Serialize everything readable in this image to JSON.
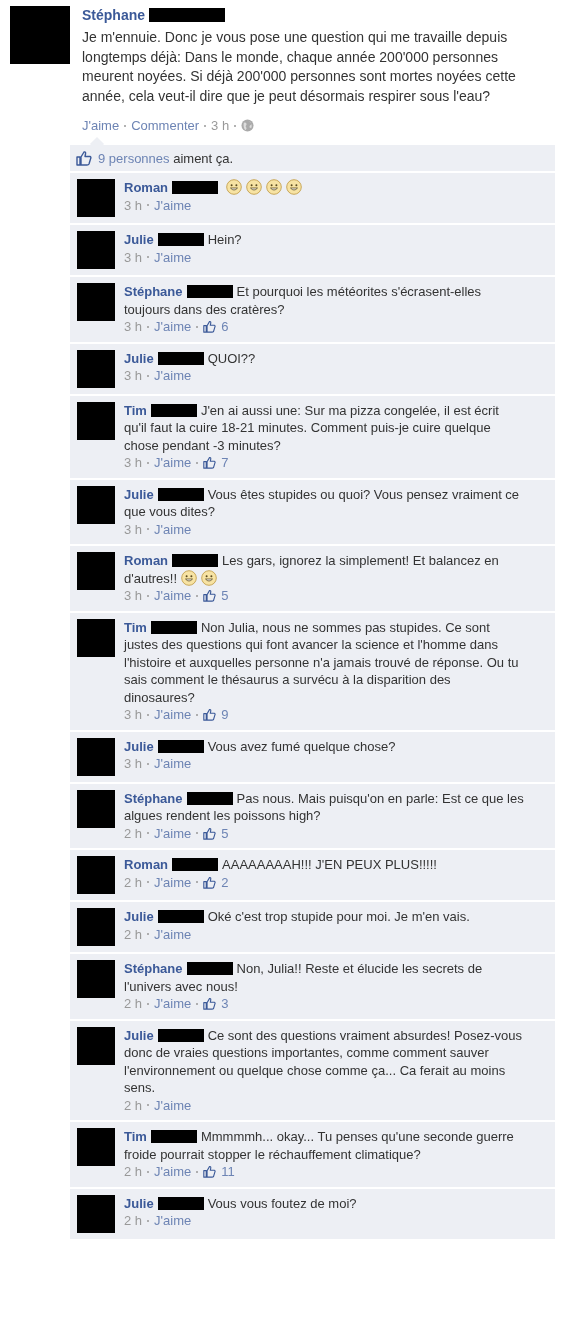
{
  "post": {
    "author": "Stéphane",
    "redacted": true,
    "text": "Je m'ennuie. Donc je vous pose une question qui me travaille depuis longtemps déjà: Dans le monde, chaque année 200'000 personnes meurent noyées. Si déjà 200'000 personnes sont mortes noyées cette année, cela veut-il dire que je peut désormais respirer sous l'eau?",
    "actions": [
      "J'aime",
      "Commenter"
    ],
    "time": "3 h"
  },
  "likes_bar": {
    "people": "9 personnes",
    "rest": "aiment ça."
  },
  "comments": [
    {
      "author": "Roman",
      "redacted": true,
      "emoticons": [
        {
          "kind": "smile"
        },
        {
          "kind": "smile"
        },
        {
          "kind": "smile"
        },
        {
          "kind": "smile"
        }
      ],
      "time": "3 h",
      "action": "J'aime"
    },
    {
      "author": "Julie",
      "redacted": true,
      "text": "Hein?",
      "time": "3 h",
      "action": "J'aime"
    },
    {
      "author": "Stéphane",
      "redacted": true,
      "text": "Et pourquoi les météorites s'écrasent-elles toujours dans des cratères?",
      "time": "3 h",
      "action": "J'aime",
      "likes": "6"
    },
    {
      "author": "Julie",
      "redacted": true,
      "text": "QUOI??",
      "time": "3 h",
      "action": "J'aime"
    },
    {
      "author": "Tim",
      "redacted": true,
      "text": "J'en ai aussi une: Sur ma pizza congelée, il est écrit qu'il faut la cuire 18-21 minutes. Comment puis-je cuire quelque chose pendant -3 minutes?",
      "time": "3 h",
      "action": "J'aime",
      "likes": "7"
    },
    {
      "author": "Julie",
      "redacted": true,
      "text": "Vous êtes stupides ou quoi? Vous pensez vraiment ce que vous dites?",
      "time": "3 h",
      "action": "J'aime"
    },
    {
      "author": "Roman",
      "redacted": true,
      "text": "Les gars, ignorez la simplement! Et balancez en d'autres!!",
      "emoticons": [
        {
          "kind": "smile"
        },
        {
          "kind": "smile"
        }
      ],
      "time": "3 h",
      "action": "J'aime",
      "likes": "5"
    },
    {
      "author": "Tim",
      "redacted": true,
      "text": "Non Julia, nous ne sommes pas stupides. Ce sont justes des questions qui font avancer la science et l'homme dans l'histoire et auxquelles personne n'a jamais trouvé de réponse. Ou tu sais comment le thésaurus a survécu à la disparition des dinosaures?",
      "time": "3 h",
      "action": "J'aime",
      "likes": "9"
    },
    {
      "author": "Julie",
      "redacted": true,
      "text": "Vous avez fumé quelque chose?",
      "time": "3 h",
      "action": "J'aime"
    },
    {
      "author": "Stéphane",
      "redacted": true,
      "text": "Pas nous. Mais puisqu'on en parle: Est ce que les algues rendent les poissons high?",
      "time": "2 h",
      "action": "J'aime",
      "likes": "5"
    },
    {
      "author": "Roman",
      "redacted": true,
      "text": "AAAAAAAAH!!! J'EN PEUX PLUS!!!!!",
      "time": "2 h",
      "action": "J'aime",
      "likes": "2"
    },
    {
      "author": "Julie",
      "redacted": true,
      "text": "Oké c'est trop stupide pour moi. Je m'en vais.",
      "time": "2 h",
      "action": "J'aime"
    },
    {
      "author": "Stéphane",
      "redacted": true,
      "text": "Non, Julia!! Reste et élucide les secrets de l'univers avec nous!",
      "time": "2 h",
      "action": "J'aime",
      "likes": "3"
    },
    {
      "author": "Julie",
      "redacted": true,
      "text": "Ce sont des questions vraiment absurdes! Posez-vous donc de vraies questions importantes, comme comment sauver l'environnement ou quelque chose comme ça... Ca ferait au moins sens.",
      "time": "2 h",
      "action": "J'aime"
    },
    {
      "author": "Tim",
      "redacted": true,
      "text": "Mmmmmh... okay... Tu penses qu'une seconde guerre froide pourrait stopper le réchauffement climatique?",
      "time": "2 h",
      "action": "J'aime",
      "likes": "11"
    },
    {
      "author": "Julie",
      "redacted": true,
      "text": "Vous vous foutez de moi?",
      "time": "2 h",
      "action": "J'aime"
    }
  ]
}
